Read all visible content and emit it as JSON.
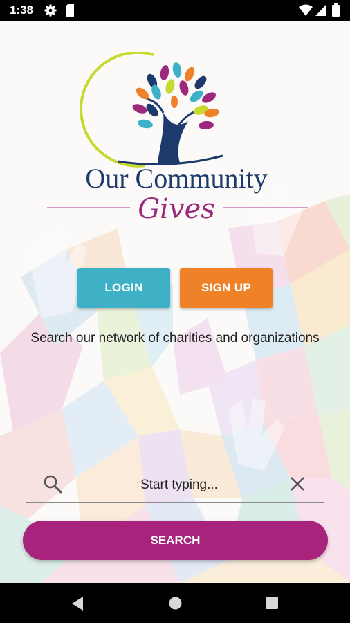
{
  "status_bar": {
    "time": "1:38",
    "icons": [
      "settings-icon",
      "sd-card-icon",
      "wifi-icon",
      "signal-icon",
      "battery-icon"
    ]
  },
  "logo": {
    "line1": "Our Community",
    "line2": "Gives"
  },
  "buttons": {
    "login_label": "LOGIN",
    "signup_label": "SIGN UP"
  },
  "tagline": "Search our network of charities and organizations",
  "search": {
    "placeholder": "Start typing...",
    "button_label": "SEARCH"
  },
  "nav": {
    "icons": [
      "back-icon",
      "home-icon",
      "recents-icon"
    ]
  },
  "colors": {
    "login": "#3fb1c6",
    "signup": "#ef8228",
    "search_button": "#a7237c",
    "logo_navy": "#1c3a6b",
    "logo_purple": "#9b2a7c"
  }
}
